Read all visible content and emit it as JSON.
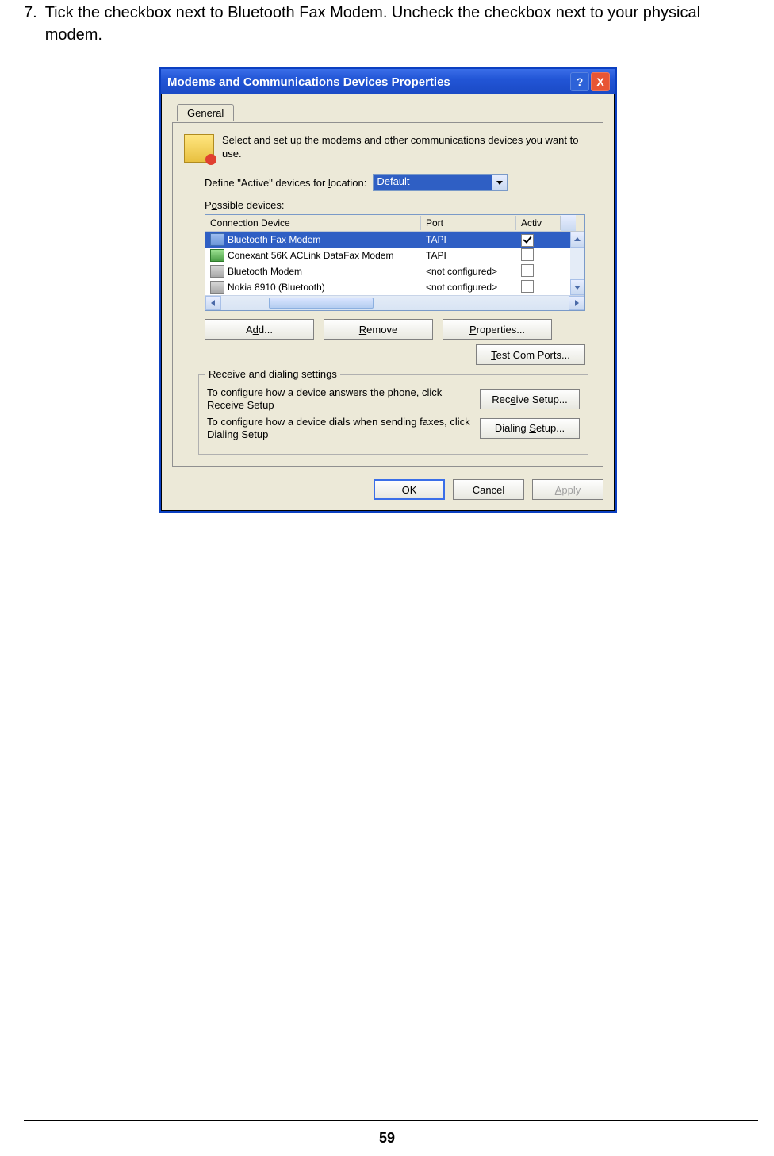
{
  "step": {
    "number": "7.",
    "text": "Tick the checkbox next to Bluetooth Fax Modem. Uncheck the checkbox next to your physical modem."
  },
  "dialog": {
    "title": "Modems and Communications Devices Properties",
    "help": "?",
    "close": "X",
    "tab": "General",
    "intro": "Select and set up the modems and other communications devices you want to use.",
    "define_label_pre": "Define \"Active\" devices for ",
    "define_label_u": "l",
    "define_label_post": "ocation:",
    "location": "Default",
    "possible_label_pre": "P",
    "possible_label_u": "o",
    "possible_label_post": "ssible devices:",
    "headers": {
      "device": "Connection Device",
      "port": "Port",
      "active": "Activ"
    },
    "devices": [
      {
        "name": "Bluetooth Fax Modem",
        "port": "TAPI",
        "checked": true,
        "selected": true,
        "icon": "ri-bt"
      },
      {
        "name": "Conexant 56K ACLink DataFax Modem",
        "port": "TAPI",
        "checked": false,
        "selected": false,
        "icon": "ri-cx"
      },
      {
        "name": "Bluetooth Modem",
        "port": "<not configured>",
        "checked": false,
        "selected": false,
        "icon": "ri-bm"
      },
      {
        "name": "Nokia 8910 (Bluetooth)",
        "port": "<not configured>",
        "checked": false,
        "selected": false,
        "icon": "ri-nk"
      }
    ],
    "buttons": {
      "add_pre": "A",
      "add_u": "d",
      "add_post": "d...",
      "remove_u": "R",
      "remove_post": "emove",
      "props_u": "P",
      "props_post": "roperties...",
      "test_u": "T",
      "test_post": "est Com Ports..."
    },
    "fieldset": {
      "legend": "Receive and dialing settings",
      "recv_text": "To configure how a device answers the phone, click Receive Setup",
      "recv_btn_pre": "Rec",
      "recv_btn_u": "e",
      "recv_btn_post": "ive Setup...",
      "dial_text": "To configure how a device dials when sending faxes, click Dialing Setup",
      "dial_btn_pre": "Dialing ",
      "dial_btn_u": "S",
      "dial_btn_post": "etup..."
    },
    "bottom": {
      "ok": "OK",
      "cancel": "Cancel",
      "apply_u": "A",
      "apply_post": "pply"
    }
  },
  "page_number": "59"
}
